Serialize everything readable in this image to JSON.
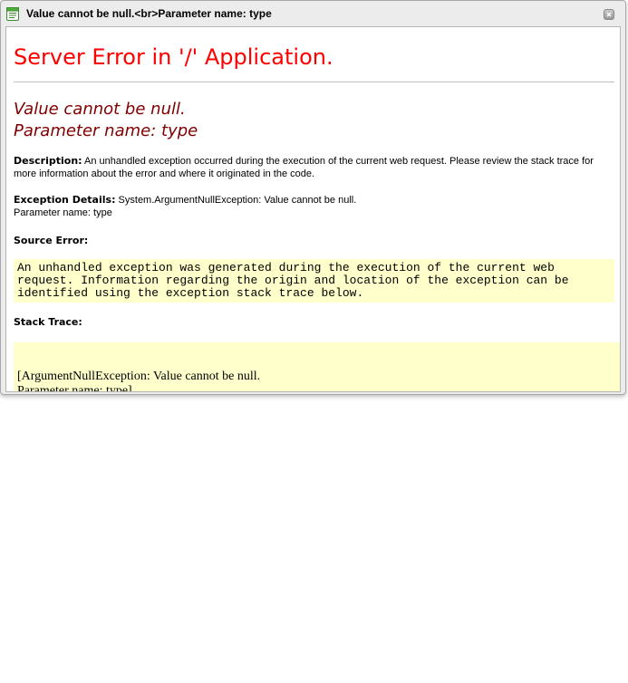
{
  "window": {
    "title": "Value cannot be null.<br>Parameter name: type",
    "icon": "document-icon",
    "close_icon": "close-icon"
  },
  "error_page": {
    "heading": "Server Error in '/' Application.",
    "message_line1": "Value cannot be null.",
    "message_line2": "Parameter name: type",
    "description_label": "Description:",
    "description_text": "An unhandled exception occurred during the execution of the current web request. Please review the stack trace for more information about the error and where it originated in the code.",
    "exception_label": "Exception Details:",
    "exception_text": "System.ArgumentNullException: Value cannot be null.",
    "exception_param": "Parameter name: type",
    "source_error_label": "Source Error:",
    "source_error_line1": "An unhandled exception was generated during the execution of the current web",
    "source_error_line2": "request. Information regarding the origin and location of the exception can be",
    "source_error_line3": "identified using the exception stack trace below.",
    "stack_trace_label": "Stack Trace:",
    "stack_line1": "[ArgumentNullException: Value cannot be null.",
    "stack_line2": "Parameter name: type]"
  },
  "colors": {
    "heading_red": "#ff0000",
    "message_maroon": "#800000",
    "code_background": "#ffffcc"
  }
}
